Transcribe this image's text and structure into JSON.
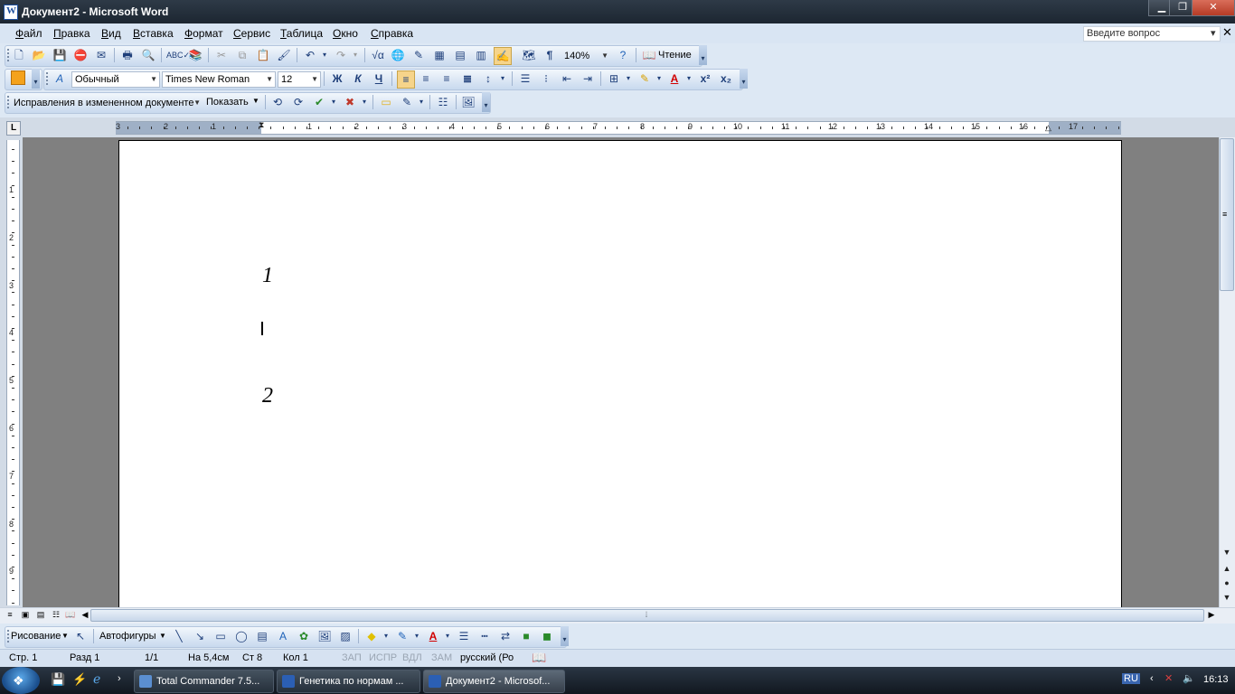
{
  "window": {
    "title": "Документ2 - Microsoft Word",
    "app_icon": "W"
  },
  "menu": {
    "items": [
      "Файл",
      "Правка",
      "Вид",
      "Вставка",
      "Формат",
      "Сервис",
      "Таблица",
      "Окно",
      "Справка"
    ],
    "help_placeholder": "Введите вопрос"
  },
  "standard_toolbar": {
    "zoom": "140%",
    "reading_label": "Чтение"
  },
  "format_toolbar": {
    "style": "Обычный",
    "font": "Times New Roman",
    "size": "12",
    "bold": "Ж",
    "italic": "К",
    "underline": "Ч"
  },
  "review_toolbar": {
    "display_mode": "Исправления в измененном документе",
    "show_label": "Показать"
  },
  "ruler": {
    "h_numbers": [
      "3",
      "2",
      "1",
      "1",
      "1",
      "2",
      "3",
      "4",
      "5",
      "6",
      "7",
      "8",
      "9",
      "10",
      "11",
      "12",
      "13",
      "14",
      "15",
      "16",
      "17"
    ],
    "v_numbers": [
      "1",
      "2",
      "3",
      "4",
      "5",
      "6",
      "7",
      "8",
      "9"
    ]
  },
  "document": {
    "text_1": "1",
    "text_2": "2"
  },
  "draw_toolbar": {
    "draw_label": "Рисование",
    "autoshapes_label": "Автофигуры"
  },
  "status": {
    "page": "Стр. 1",
    "section": "Разд 1",
    "pages": "1/1",
    "at": "На 5,4см",
    "line": "Ст 8",
    "col": "Кол 1",
    "rec": "ЗАП",
    "trk": "ИСПР",
    "ext": "ВДЛ",
    "ovr": "ЗАМ",
    "lang": "русский (Ро"
  },
  "taskbar": {
    "tasks": [
      "Total Commander 7.5...",
      "Генетика по нормам ...",
      "Документ2 - Microsof..."
    ],
    "lang": "RU",
    "time": "16:13"
  },
  "colors": {
    "titlebar": "#1c2631",
    "menubar": "#d9e5f3",
    "toolbar": "#dde8f4",
    "page": "#ffffff",
    "workspace": "#808080"
  }
}
